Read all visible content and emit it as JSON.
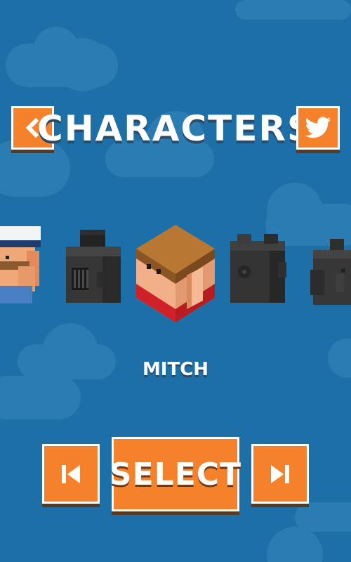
{
  "screen": {
    "title": "CHARACTERS",
    "selected_character_name": "MITCH"
  },
  "buttons": {
    "back_icon": "chevron-left-icon",
    "twitter_icon": "twitter-bird-icon",
    "prev_icon": "skip-previous-icon",
    "next_icon": "skip-next-icon",
    "select_label": "SELECT"
  },
  "characters": [
    {
      "id": "sailor",
      "state": "unlocked"
    },
    {
      "id": "knight-helmet",
      "state": "locked"
    },
    {
      "id": "mitch",
      "state": "unlocked",
      "selected": true
    },
    {
      "id": "cyclops",
      "state": "locked"
    },
    {
      "id": "elephant",
      "state": "locked"
    }
  ],
  "colors": {
    "background": "#1d6fa8",
    "button": "#f5822a",
    "button_border": "#ffffff",
    "locked_character": "#3a3a3a"
  }
}
